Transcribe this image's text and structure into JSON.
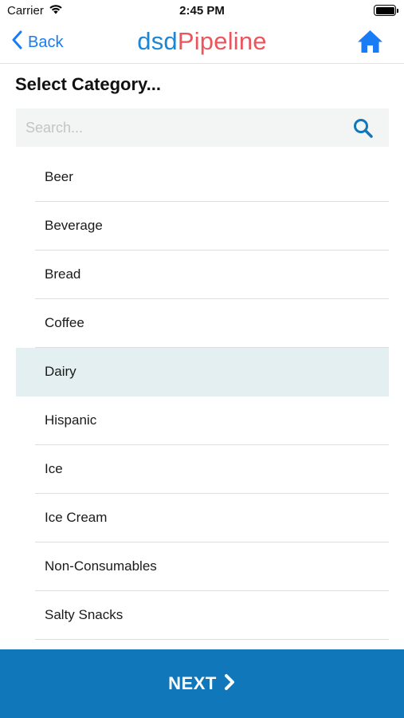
{
  "status_bar": {
    "carrier": "Carrier",
    "time": "2:45 PM"
  },
  "nav": {
    "back_label": "Back",
    "logo_part1": "dsd",
    "logo_part2": "Pipeline",
    "home_icon": "home-icon",
    "accent_color": "#1a7cf4"
  },
  "page": {
    "title": "Select Category..."
  },
  "search": {
    "placeholder": "Search...",
    "value": "",
    "icon": "search-icon"
  },
  "categories": [
    {
      "label": "Beer",
      "selected": false
    },
    {
      "label": "Beverage",
      "selected": false
    },
    {
      "label": "Bread",
      "selected": false
    },
    {
      "label": "Coffee",
      "selected": false
    },
    {
      "label": "Dairy",
      "selected": true
    },
    {
      "label": "Hispanic",
      "selected": false
    },
    {
      "label": "Ice",
      "selected": false
    },
    {
      "label": "Ice Cream",
      "selected": false
    },
    {
      "label": "Non-Consumables",
      "selected": false
    },
    {
      "label": "Salty Snacks",
      "selected": false
    }
  ],
  "footer": {
    "next_label": "NEXT",
    "next_icon": "chevron-right-icon",
    "bar_color": "#1077bb"
  },
  "colors": {
    "selected_row": "#e4eff1",
    "logo_blue": "#1a86d4",
    "logo_red": "#e9565d"
  }
}
